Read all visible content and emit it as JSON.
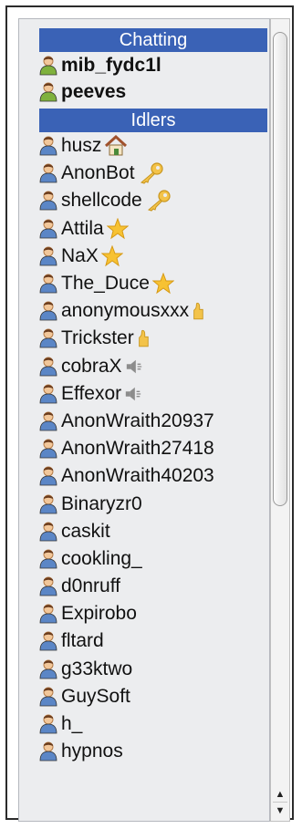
{
  "sections": {
    "chatting": {
      "header": "Chatting",
      "users": [
        {
          "name": "mib_fydc1l"
        },
        {
          "name": "peeves"
        }
      ]
    },
    "idlers": {
      "header": "Idlers",
      "users": [
        {
          "name": "husz",
          "badge": "home-icon"
        },
        {
          "name": "AnonBot",
          "badge": "key-icon"
        },
        {
          "name": "shellcode",
          "badge": "key-icon"
        },
        {
          "name": "Attila",
          "badge": "star-icon"
        },
        {
          "name": "NaX",
          "badge": "star-icon"
        },
        {
          "name": "The_Duce",
          "badge": "star-icon"
        },
        {
          "name": "anonymousxxx",
          "badge": "thumbs-up-icon"
        },
        {
          "name": "Trickster",
          "badge": "thumbs-up-icon"
        },
        {
          "name": "cobraX",
          "badge": "speaker-icon"
        },
        {
          "name": "Effexor",
          "badge": "speaker-icon"
        },
        {
          "name": "AnonWraith20937"
        },
        {
          "name": "AnonWraith27418"
        },
        {
          "name": "AnonWraith40203"
        },
        {
          "name": "Binaryzr0"
        },
        {
          "name": "caskit"
        },
        {
          "name": "cookling_"
        },
        {
          "name": "d0nruff"
        },
        {
          "name": "Expirobo"
        },
        {
          "name": "fltard"
        },
        {
          "name": "g33ktwo"
        },
        {
          "name": "GuySoft"
        },
        {
          "name": "h_"
        },
        {
          "name": "hypnos"
        }
      ]
    }
  },
  "colors": {
    "header_bg": "#3a62b6",
    "chatting_user_icon": "#7fb13d",
    "idler_user_icon": "#5b86c6"
  },
  "scrollbar": {
    "up_arrow": "▲",
    "down_arrow": "▼"
  }
}
